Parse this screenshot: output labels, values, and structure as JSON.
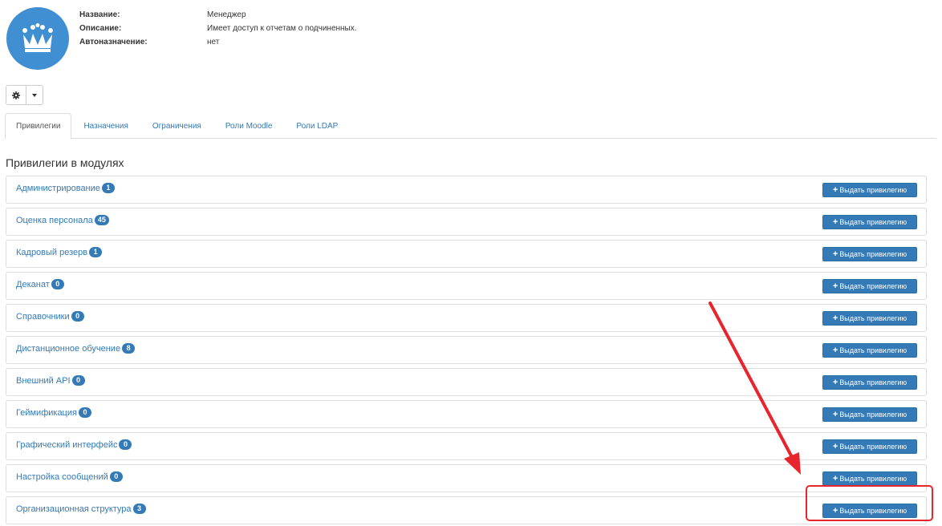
{
  "role": {
    "fields": [
      {
        "label": "Название:",
        "value": "Менеджер"
      },
      {
        "label": "Описание:",
        "value": "Имеет доступ к отчетам о подчиненных."
      },
      {
        "label": "Автоназначение:",
        "value": "нет"
      }
    ]
  },
  "tabs": [
    {
      "label": "Привилегии",
      "active": true
    },
    {
      "label": "Назначения"
    },
    {
      "label": "Ограничения"
    },
    {
      "label": "Роли Moodle"
    },
    {
      "label": "Роли LDAP"
    }
  ],
  "section_title": "Привилегии в модулях",
  "grant_button_label": "Выдать привилегию",
  "modules": [
    {
      "name": "Администрирование",
      "count": "1"
    },
    {
      "name": "Оценка персонала",
      "count": "45"
    },
    {
      "name": "Кадровый резерв",
      "count": "1"
    },
    {
      "name": "Деканат",
      "count": "0"
    },
    {
      "name": "Справочники",
      "count": "0"
    },
    {
      "name": "Дистанционное обучение",
      "count": "8"
    },
    {
      "name": "Внешний API",
      "count": "0"
    },
    {
      "name": "Геймификация",
      "count": "0"
    },
    {
      "name": "Графический интерфейс",
      "count": "0"
    },
    {
      "name": "Настройка сообщений",
      "count": "0"
    },
    {
      "name": "Организационная структура",
      "count": "3"
    }
  ],
  "colors": {
    "accent": "#337ab7",
    "avatar": "#3f8fd2",
    "annotation": "#e8242c"
  },
  "icons": {
    "avatar": "crown-icon",
    "settings": "gear-icon",
    "dropdown": "caret-down-icon",
    "grant": "plus-icon"
  }
}
